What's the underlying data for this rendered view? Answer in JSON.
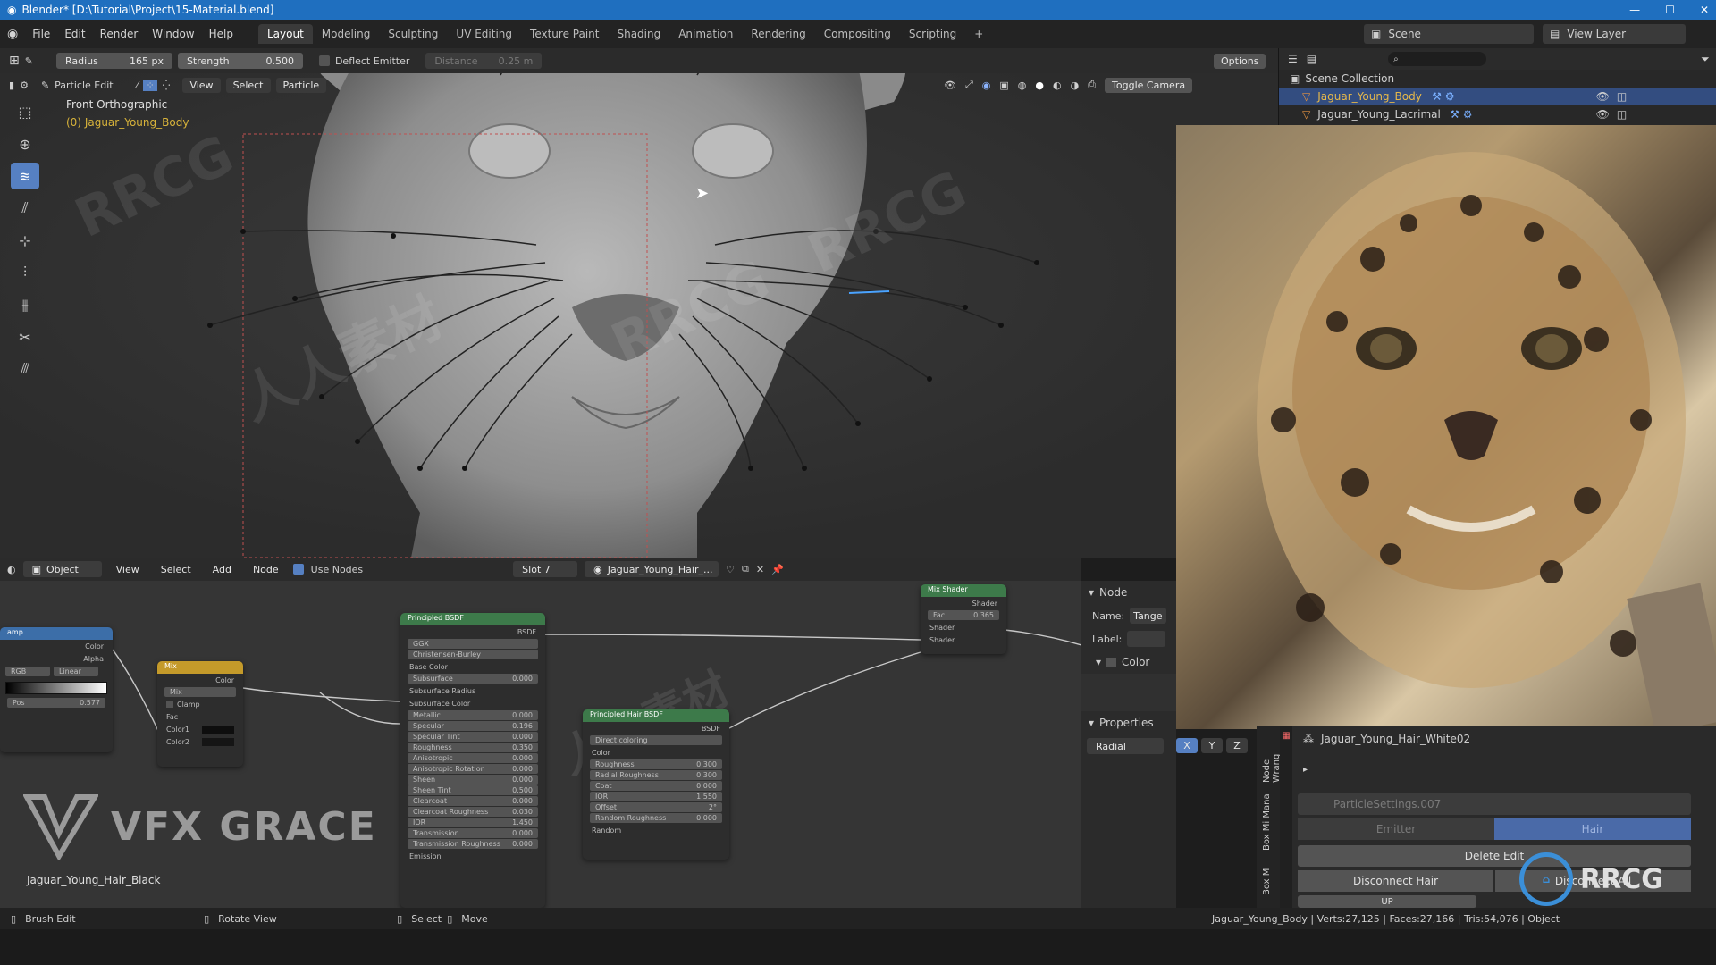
{
  "title_bar": {
    "text": "Blender* [D:\\Tutorial\\Project\\15-Material.blend]"
  },
  "menu": [
    "File",
    "Edit",
    "Render",
    "Window",
    "Help"
  ],
  "workspaces": [
    "Layout",
    "Modeling",
    "Sculpting",
    "UV Editing",
    "Texture Paint",
    "Shading",
    "Animation",
    "Rendering",
    "Compositing",
    "Scripting"
  ],
  "scene": {
    "label": "Scene",
    "view_layer": "View Layer"
  },
  "tool_settings": {
    "radius_label": "Radius",
    "radius_value": "165 px",
    "strength_label": "Strength",
    "strength_value": "0.500",
    "deflect_emitter": "Deflect Emitter",
    "distance_label": "Distance",
    "distance_value": "0.25 m",
    "options": "Options"
  },
  "viewport_header": {
    "mode": "Particle Edit",
    "view": "View",
    "select": "Select",
    "particle": "Particle",
    "toggle_camera": "Toggle Camera"
  },
  "viewport_overlay": {
    "view_name": "Front Orthographic",
    "object": "(0) Jaguar_Young_Body"
  },
  "outliner": {
    "collection": "Scene Collection",
    "items": [
      "Jaguar_Young_Body",
      "Jaguar_Young_Lacrimal"
    ]
  },
  "node_header": {
    "object": "Object",
    "view": "View",
    "select": "Select",
    "add": "Add",
    "node": "Node",
    "use_nodes": "Use Nodes",
    "slot": "Slot 7",
    "material": "Jaguar_Young_Hair_..."
  },
  "node_sidebar": {
    "section": "Node",
    "name_label": "Name:",
    "name_value": "Tange",
    "label_label": "Label:",
    "color": "Color",
    "properties": "Properties",
    "radial": "Radial",
    "x": "X",
    "y": "Y",
    "z": "Z"
  },
  "node_tabs": [
    "Node Wrang",
    "Box Mi Mana",
    "Box M"
  ],
  "nodes": {
    "ramp": {
      "title": "amp",
      "out1": "Color",
      "out2": "Alpha",
      "mode": "RGB",
      "interp": "Linear",
      "pos_label": "Pos",
      "pos_value": "0.577"
    },
    "mix": {
      "title": "Mix",
      "out": "Color",
      "blend": "Mix",
      "clamp": "Clamp",
      "fac": "Fac",
      "c1": "Color1",
      "c2": "Color2"
    },
    "principled": {
      "title": "Principled BSDF",
      "out": "BSDF",
      "dist": "GGX",
      "sss": "Christensen-Burley",
      "rows": [
        [
          "Base Color",
          ""
        ],
        [
          "Subsurface",
          "0.000"
        ],
        [
          "Subsurface Radius",
          ""
        ],
        [
          "Subsurface Color",
          ""
        ],
        [
          "Metallic",
          "0.000"
        ],
        [
          "Specular",
          "0.196"
        ],
        [
          "Specular Tint",
          "0.000"
        ],
        [
          "Roughness",
          "0.350"
        ],
        [
          "Anisotropic",
          "0.000"
        ],
        [
          "Anisotropic Rotation",
          "0.000"
        ],
        [
          "Sheen",
          "0.000"
        ],
        [
          "Sheen Tint",
          "0.500"
        ],
        [
          "Clearcoat",
          "0.000"
        ],
        [
          "Clearcoat Roughness",
          "0.030"
        ],
        [
          "IOR",
          "1.450"
        ],
        [
          "Transmission",
          "0.000"
        ],
        [
          "Transmission Roughness",
          "0.000"
        ],
        [
          "Emission",
          ""
        ]
      ]
    },
    "hair": {
      "title": "Principled Hair BSDF",
      "out": "BSDF",
      "mode": "Direct coloring",
      "rows": [
        [
          "Color",
          ""
        ],
        [
          "Roughness",
          "0.300"
        ],
        [
          "Radial Roughness",
          "0.300"
        ],
        [
          "Coat",
          "0.000"
        ],
        [
          "IOR",
          "1.550"
        ],
        [
          "Offset",
          "2°"
        ],
        [
          "Random Roughness",
          "0.000"
        ],
        [
          "Random",
          ""
        ]
      ]
    },
    "mixshader": {
      "title": "Mix Shader",
      "out": "Shader",
      "fac": "Fac",
      "fac_value": "0.365",
      "in1": "Shader",
      "in2": "Shader"
    }
  },
  "brand": {
    "logo": "VFX GRACE",
    "caption": "Jaguar_Young_Hair_Black"
  },
  "properties": {
    "particle_name": "Jaguar_Young_Hair_White02",
    "settings": "ParticleSettings.007",
    "emitter": "Emitter",
    "hair": "Hair",
    "delete_edit": "Delete Edit",
    "disconnect_hair": "Disconnect Hair",
    "disconnect_all": "Disconnect All",
    "up": "UP"
  },
  "status_bar": {
    "brush_edit": "Brush Edit",
    "rotate_view": "Rotate View",
    "select": "Select",
    "move": "Move",
    "stats": "Jaguar_Young_Body | Verts:27,125 | Faces:27,166 | Tris:54,076 | Object"
  },
  "watermarks": [
    "RRCG",
    "人人素材"
  ],
  "colors": {
    "accent": "#5680c2",
    "titlebar": "#1f6fbf",
    "shader_green": "#3d7a4a",
    "converter_blue": "#3c6ea8",
    "color_node": "#c49a2a"
  }
}
